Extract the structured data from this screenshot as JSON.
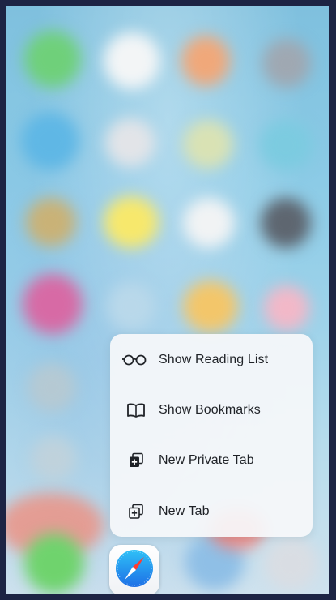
{
  "quick_actions": {
    "items": [
      {
        "label": "Show Reading List",
        "icon": "reading-glasses-icon"
      },
      {
        "label": "Show Bookmarks",
        "icon": "book-icon"
      },
      {
        "label": "New Private Tab",
        "icon": "private-tab-icon"
      },
      {
        "label": "New Tab",
        "icon": "new-tab-icon"
      }
    ]
  },
  "app": {
    "name": "Safari",
    "icon": "safari-compass-icon"
  }
}
